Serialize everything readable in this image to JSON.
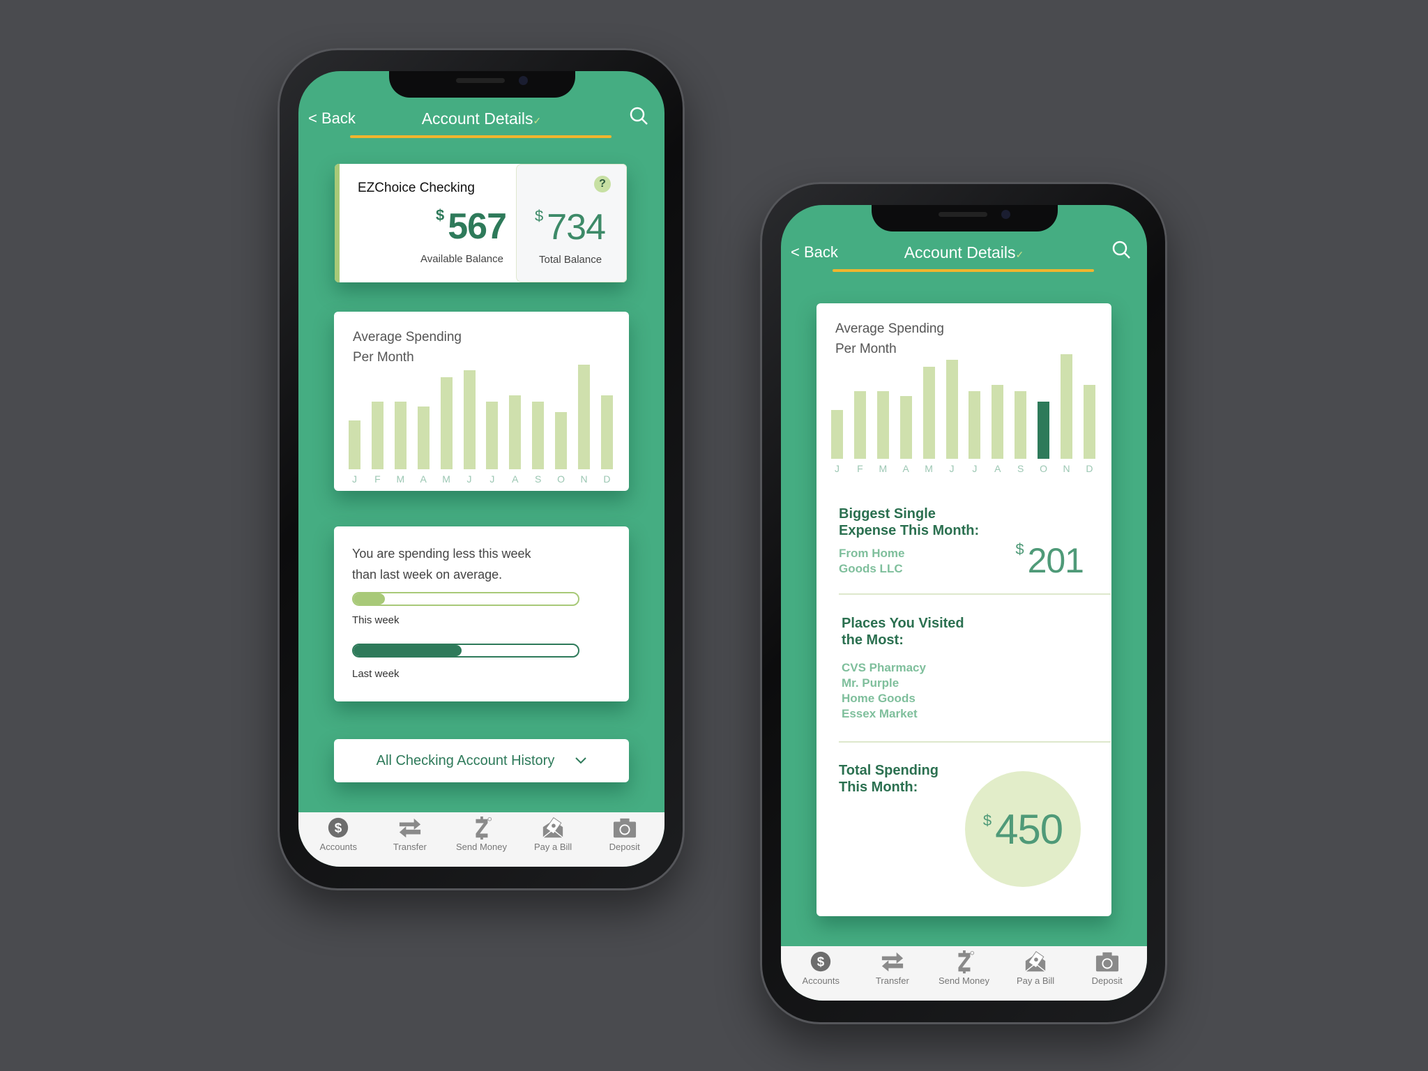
{
  "colors": {
    "background": "#4a4b4f",
    "primary_green": "#45ad82",
    "dark_green": "#2e7a5a",
    "light_green": "#cfe0ad",
    "accent_underline": "#f0b52e",
    "highlight_bar": "#2e7a5a"
  },
  "header": {
    "back_label": "Back",
    "title": "Account Details",
    "title_chevron": "✓",
    "search_icon": "search-icon"
  },
  "account": {
    "name": "EZChoice Checking",
    "currency": "$",
    "available_balance": "567",
    "available_label": "Available Balance",
    "total_balance": "734",
    "total_label": "Total Balance",
    "help": "?"
  },
  "chart_data": {
    "type": "bar",
    "title": "Average Spending Per Month",
    "title_lines": [
      "Average Spending",
      "Per Month"
    ],
    "categories": [
      "J",
      "F",
      "M",
      "A",
      "M",
      "J",
      "J",
      "A",
      "S",
      "O",
      "N",
      "D"
    ],
    "values": [
      47,
      65,
      65,
      60,
      88,
      95,
      65,
      71,
      65,
      55,
      100,
      71
    ],
    "highlight_index_right_phone": 9,
    "grid": false
  },
  "progress": {
    "text_lines": [
      "You are spending less this week",
      "than last week on average."
    ],
    "this_week_label": "This week",
    "this_week_fraction": 0.14,
    "last_week_label": "Last week",
    "last_week_fraction": 0.48
  },
  "history_button": {
    "label": "All Checking Account History"
  },
  "details": {
    "biggest_title_lines": [
      "Biggest Single",
      "Expense This Month:"
    ],
    "biggest_from_lines": [
      "From Home",
      "Goods LLC"
    ],
    "biggest_amount": "201",
    "places_title_lines": [
      "Places You Visited",
      "the Most:"
    ],
    "places": [
      "CVS Pharmacy",
      "Mr. Purple",
      "Home Goods",
      "Essex Market"
    ],
    "total_title_lines": [
      "Total Spending",
      "This Month:"
    ],
    "total_amount": "450",
    "currency": "$"
  },
  "tabs": [
    {
      "label": "Accounts",
      "icon": "dollar-icon"
    },
    {
      "label": "Transfer",
      "icon": "transfer-icon"
    },
    {
      "label": "Send Money",
      "icon": "zelle-icon"
    },
    {
      "label": "Pay a Bill",
      "icon": "envelope-bill-icon"
    },
    {
      "label": "Deposit",
      "icon": "camera-icon"
    }
  ]
}
